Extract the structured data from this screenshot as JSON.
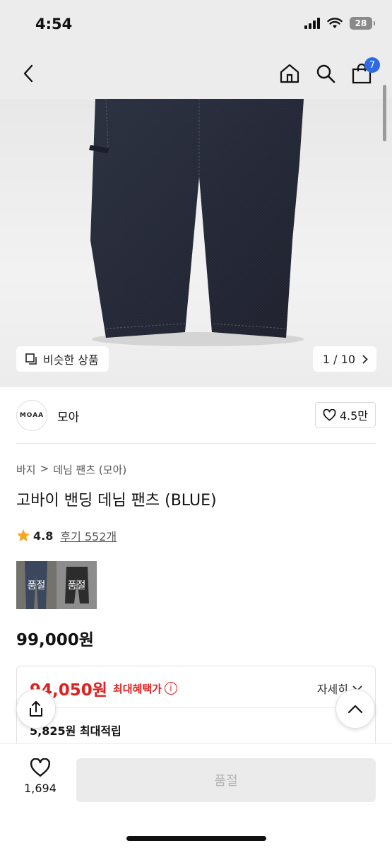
{
  "status_bar": {
    "time": "4:54",
    "battery": "28"
  },
  "header": {
    "cart_count": "7"
  },
  "gallery": {
    "similar_label": "비슷한 상품",
    "counter": "1 / 10"
  },
  "brand": {
    "logo_text": "MOAA",
    "name": "모아",
    "likes": "4.5만"
  },
  "product": {
    "breadcrumb": [
      "바지",
      "데님 팬츠 (모아)"
    ],
    "title": "고바이 밴딩 데님 팬츠 (BLUE)",
    "rating": "4.8",
    "review_label": "후기 552개",
    "options": [
      {
        "label": "품절"
      },
      {
        "label": "품절"
      }
    ],
    "price": "99,000원"
  },
  "benefit": {
    "sale_price": "94,050원",
    "max_benefit_label": "최대혜택가",
    "detail_label": "자세히",
    "points": "5,825원 최대적립"
  },
  "bottom_bar": {
    "wish_count": "1,694",
    "buy_label": "품절"
  },
  "colors": {
    "accent_red": "#e02020",
    "badge_blue": "#2d6ae3",
    "denim": "#262b38"
  }
}
